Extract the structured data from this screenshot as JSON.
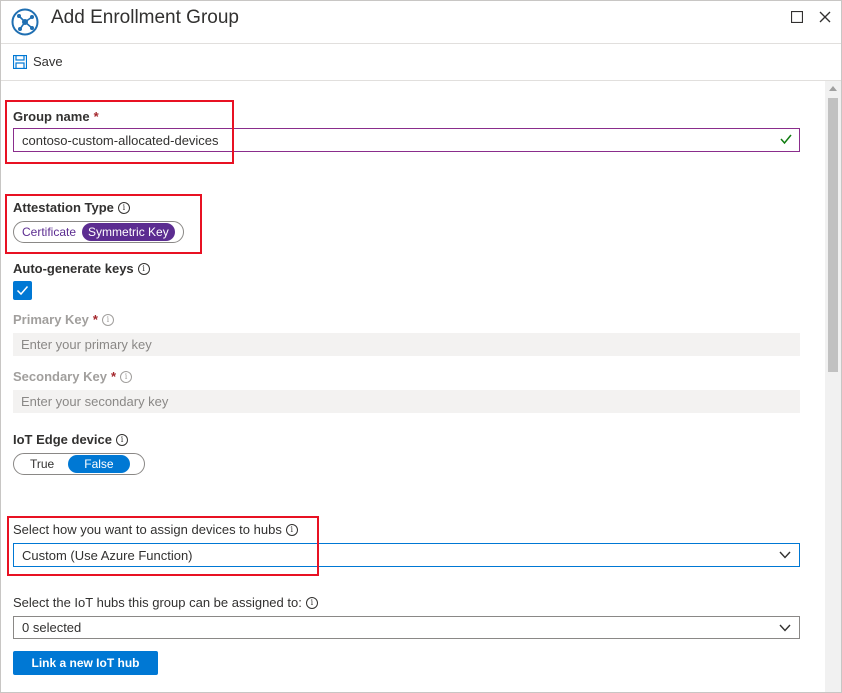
{
  "window": {
    "title": "Add Enrollment Group"
  },
  "toolbar": {
    "save_label": "Save"
  },
  "form": {
    "group_name": {
      "label": "Group name",
      "required_mark": "*",
      "value": "contoso-custom-allocated-devices"
    },
    "attestation": {
      "label": "Attestation Type",
      "options": [
        "Certificate",
        "Symmetric Key"
      ],
      "selected": "Symmetric Key"
    },
    "auto_generate": {
      "label": "Auto-generate keys",
      "checked": true
    },
    "primary_key": {
      "label": "Primary Key",
      "required_mark": "*",
      "placeholder": "Enter your primary key"
    },
    "secondary_key": {
      "label": "Secondary Key",
      "required_mark": "*",
      "placeholder": "Enter your secondary key"
    },
    "iot_edge": {
      "label": "IoT Edge device",
      "options": [
        "True",
        "False"
      ],
      "selected": "False"
    },
    "assign_policy": {
      "label": "Select how you want to assign devices to hubs",
      "value": "Custom (Use Azure Function)"
    },
    "iot_hubs": {
      "label": "Select the IoT hubs this group can be assigned to:",
      "value": "0 selected"
    },
    "link_hub_button": "Link a new IoT hub"
  },
  "colors": {
    "accent": "#0078d4",
    "attestation_selected": "#5c2d91",
    "highlight": "#e81123",
    "valid": "#107c10"
  }
}
